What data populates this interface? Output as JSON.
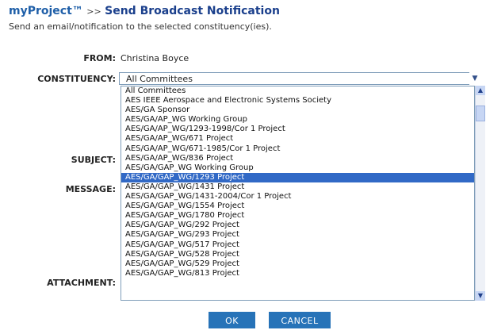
{
  "header": {
    "app_name": "myProject™",
    "separator": ">>",
    "page_title": "Send Broadcast Notification",
    "description": "Send an email/notification to the selected constituency(ies)."
  },
  "form": {
    "from_label": "FROM:",
    "from_value": "Christina Boyce",
    "constituency_label": "CONSTITUENCY:",
    "constituency_selected": "All Committees",
    "subject_label": "SUBJECT:",
    "message_label": "MESSAGE:",
    "attachment_label": "ATTACHMENT:"
  },
  "dropdown": {
    "options": [
      "All Committees",
      "AES IEEE Aerospace and Electronic Systems Society",
      "AES/GA Sponsor",
      "AES/GA/AP_WG Working Group",
      "AES/GA/AP_WG/1293-1998/Cor 1 Project",
      "AES/GA/AP_WG/671 Project",
      "AES/GA/AP_WG/671-1985/Cor 1 Project",
      "AES/GA/AP_WG/836 Project",
      "AES/GA/GAP_WG Working Group",
      "AES/GA/GAP_WG/1293 Project",
      "AES/GA/GAP_WG/1431 Project",
      "AES/GA/GAP_WG/1431-2004/Cor 1 Project",
      "AES/GA/GAP_WG/1554 Project",
      "AES/GA/GAP_WG/1780 Project",
      "AES/GA/GAP_WG/292 Project",
      "AES/GA/GAP_WG/293 Project",
      "AES/GA/GAP_WG/517 Project",
      "AES/GA/GAP_WG/528 Project",
      "AES/GA/GAP_WG/529 Project",
      "AES/GA/GAP_WG/813 Project"
    ],
    "highlighted": "AES/GA/GAP_WG/1293 Project"
  },
  "buttons": {
    "ok": "OK",
    "cancel": "CANCEL"
  },
  "icons": {
    "dropdown_arrow": "chevron-down-icon",
    "scroll_up": "arrow-up-icon",
    "scroll_down": "arrow-down-icon"
  },
  "colors": {
    "accent": "#1f5fa8",
    "highlight": "#3169c6",
    "button": "#2773b8"
  }
}
